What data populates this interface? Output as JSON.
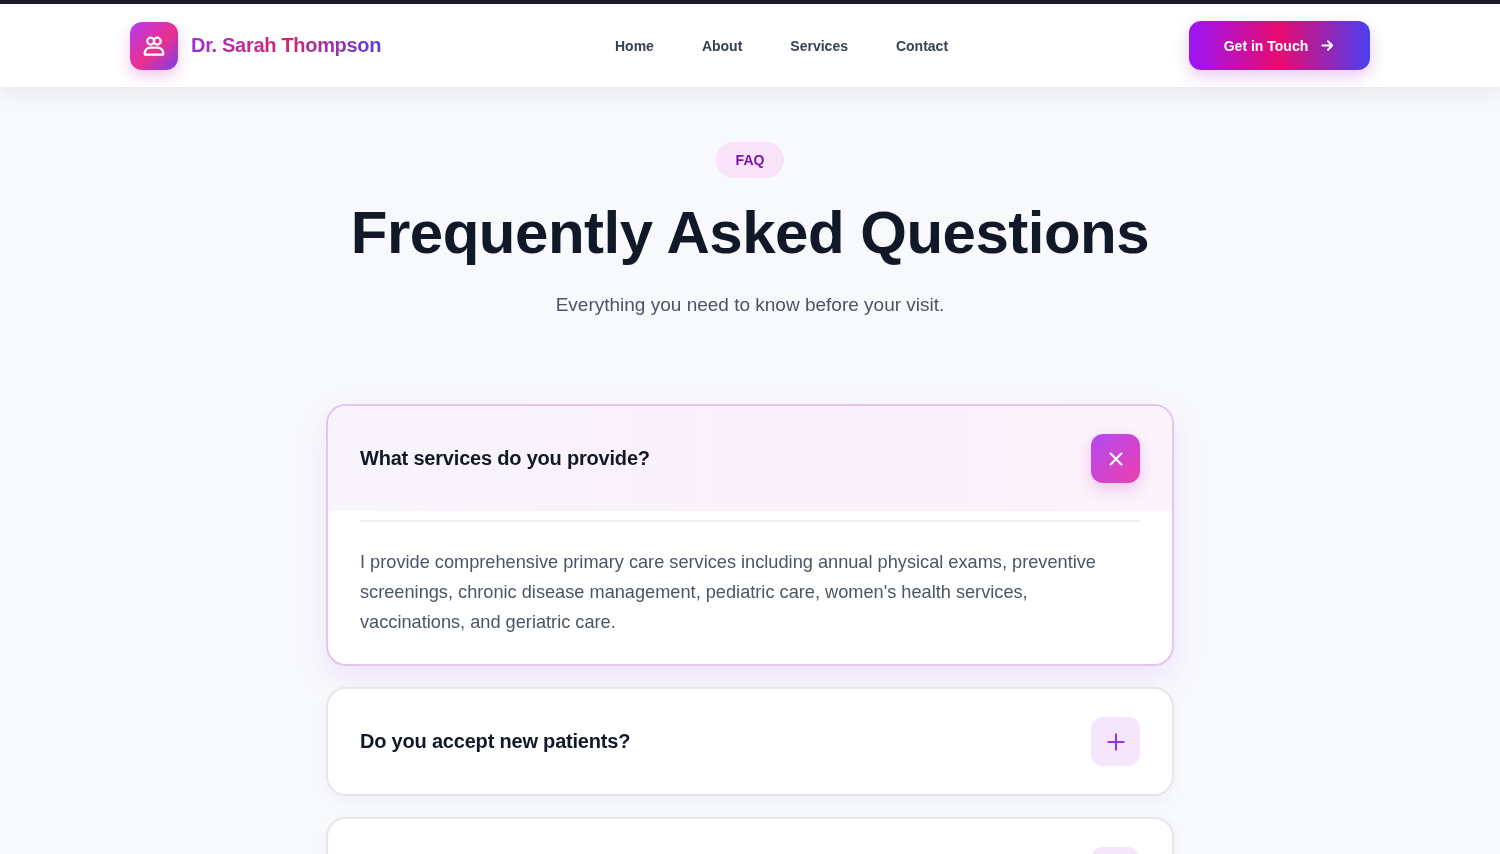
{
  "header": {
    "brand": "Dr. Sarah Thompson",
    "nav": [
      "Home",
      "About",
      "Services",
      "Contact"
    ],
    "cta": "Get in Touch"
  },
  "hero": {
    "badge": "FAQ",
    "title": "Frequently Asked Questions",
    "subtitle": "Everything you need to know before your visit."
  },
  "faq": [
    {
      "question": "What services do you provide?",
      "expanded": true,
      "answer": "I provide comprehensive primary care services including annual physical exams, preventive screenings, chronic disease management, pediatric care, women's health services, vaccinations, and geriatric care."
    },
    {
      "question": "Do you accept new patients?",
      "expanded": false
    },
    {
      "expanded": false
    }
  ]
}
